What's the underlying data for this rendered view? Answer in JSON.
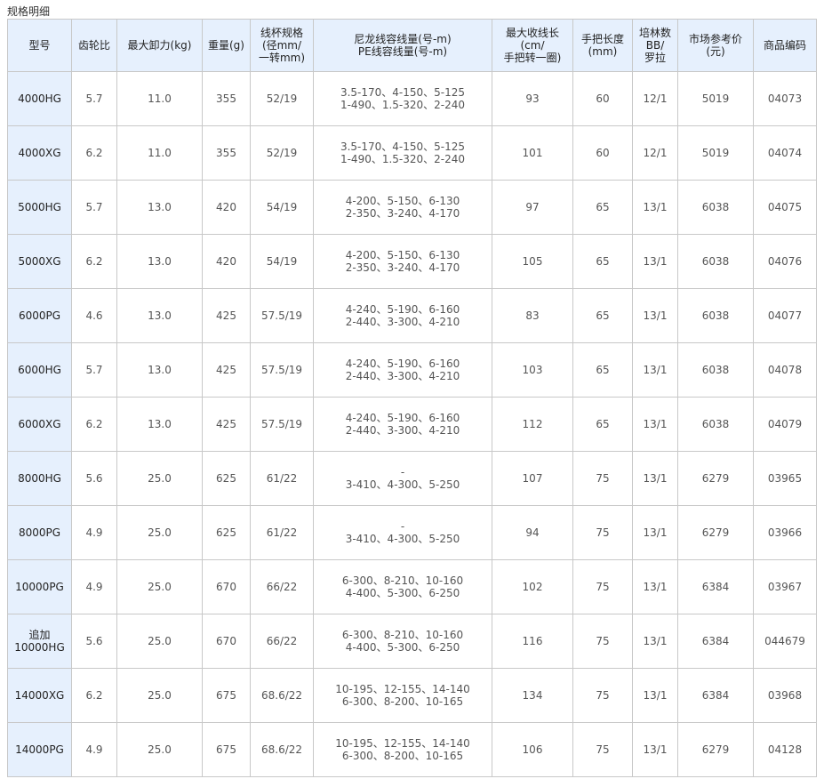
{
  "section_title": "规格明细",
  "headers": [
    [
      "型号"
    ],
    [
      "齿轮比"
    ],
    [
      "最大卸力(kg)"
    ],
    [
      "重量(g)"
    ],
    [
      "线杯规格",
      "(径mm/",
      "一转mm)"
    ],
    [
      "尼龙线容线量(号-m)",
      "PE线容线量(号-m)"
    ],
    [
      "最大收线长",
      "(cm/",
      "手把转一圈)"
    ],
    [
      "手把长度",
      "(mm)"
    ],
    [
      "培林数",
      "BB/",
      "罗拉"
    ],
    [
      "市场参考价",
      "(元)"
    ],
    [
      "商品编码"
    ]
  ],
  "rows": [
    {
      "model": [
        "4000HG"
      ],
      "ratio": "5.7",
      "drag": "11.0",
      "weight": "355",
      "spool": "52/19",
      "capacity": [
        "3.5-170、4-150、5-125",
        "1-490、1.5-320、2-240"
      ],
      "retrieve": "93",
      "handle": "60",
      "bearings": "12/1",
      "price": "5019",
      "code": "04073"
    },
    {
      "model": [
        "4000XG"
      ],
      "ratio": "6.2",
      "drag": "11.0",
      "weight": "355",
      "spool": "52/19",
      "capacity": [
        "3.5-170、4-150、5-125",
        "1-490、1.5-320、2-240"
      ],
      "retrieve": "101",
      "handle": "60",
      "bearings": "12/1",
      "price": "5019",
      "code": "04074"
    },
    {
      "model": [
        "5000HG"
      ],
      "ratio": "5.7",
      "drag": "13.0",
      "weight": "420",
      "spool": "54/19",
      "capacity": [
        "4-200、5-150、6-130",
        "2-350、3-240、4-170"
      ],
      "retrieve": "97",
      "handle": "65",
      "bearings": "13/1",
      "price": "6038",
      "code": "04075"
    },
    {
      "model": [
        "5000XG"
      ],
      "ratio": "6.2",
      "drag": "13.0",
      "weight": "420",
      "spool": "54/19",
      "capacity": [
        "4-200、5-150、6-130",
        "2-350、3-240、4-170"
      ],
      "retrieve": "105",
      "handle": "65",
      "bearings": "13/1",
      "price": "6038",
      "code": "04076"
    },
    {
      "model": [
        "6000PG"
      ],
      "ratio": "4.6",
      "drag": "13.0",
      "weight": "425",
      "spool": "57.5/19",
      "capacity": [
        "4-240、5-190、6-160",
        "2-440、3-300、4-210"
      ],
      "retrieve": "83",
      "handle": "65",
      "bearings": "13/1",
      "price": "6038",
      "code": "04077"
    },
    {
      "model": [
        "6000HG"
      ],
      "ratio": "5.7",
      "drag": "13.0",
      "weight": "425",
      "spool": "57.5/19",
      "capacity": [
        "4-240、5-190、6-160",
        "2-440、3-300、4-210"
      ],
      "retrieve": "103",
      "handle": "65",
      "bearings": "13/1",
      "price": "6038",
      "code": "04078"
    },
    {
      "model": [
        "6000XG"
      ],
      "ratio": "6.2",
      "drag": "13.0",
      "weight": "425",
      "spool": "57.5/19",
      "capacity": [
        "4-240、5-190、6-160",
        "2-440、3-300、4-210"
      ],
      "retrieve": "112",
      "handle": "65",
      "bearings": "13/1",
      "price": "6038",
      "code": "04079"
    },
    {
      "model": [
        "8000HG"
      ],
      "ratio": "5.6",
      "drag": "25.0",
      "weight": "625",
      "spool": "61/22",
      "capacity": [
        "-",
        "3-410、4-300、5-250"
      ],
      "retrieve": "107",
      "handle": "75",
      "bearings": "13/1",
      "price": "6279",
      "code": "03965"
    },
    {
      "model": [
        "8000PG"
      ],
      "ratio": "4.9",
      "drag": "25.0",
      "weight": "625",
      "spool": "61/22",
      "capacity": [
        "-",
        "3-410、4-300、5-250"
      ],
      "retrieve": "94",
      "handle": "75",
      "bearings": "13/1",
      "price": "6279",
      "code": "03966"
    },
    {
      "model": [
        "10000PG"
      ],
      "ratio": "4.9",
      "drag": "25.0",
      "weight": "670",
      "spool": "66/22",
      "capacity": [
        "6-300、8-210、10-160",
        "4-400、5-300、6-250"
      ],
      "retrieve": "102",
      "handle": "75",
      "bearings": "13/1",
      "price": "6384",
      "code": "03967"
    },
    {
      "model": [
        "追加",
        "10000HG"
      ],
      "ratio": "5.6",
      "drag": "25.0",
      "weight": "670",
      "spool": "66/22",
      "capacity": [
        "6-300、8-210、10-160",
        "4-400、5-300、6-250"
      ],
      "retrieve": "116",
      "handle": "75",
      "bearings": "13/1",
      "price": "6384",
      "code": "044679"
    },
    {
      "model": [
        "14000XG"
      ],
      "ratio": "6.2",
      "drag": "25.0",
      "weight": "675",
      "spool": "68.6/22",
      "capacity": [
        "10-195、12-155、14-140",
        "6-300、8-200、10-165"
      ],
      "retrieve": "134",
      "handle": "75",
      "bearings": "13/1",
      "price": "6384",
      "code": "03968"
    },
    {
      "model": [
        "14000PG"
      ],
      "ratio": "4.9",
      "drag": "25.0",
      "weight": "675",
      "spool": "68.6/22",
      "capacity": [
        "10-195、12-155、14-140",
        "6-300、8-200、10-165"
      ],
      "retrieve": "106",
      "handle": "75",
      "bearings": "13/1",
      "price": "6279",
      "code": "04128"
    }
  ]
}
